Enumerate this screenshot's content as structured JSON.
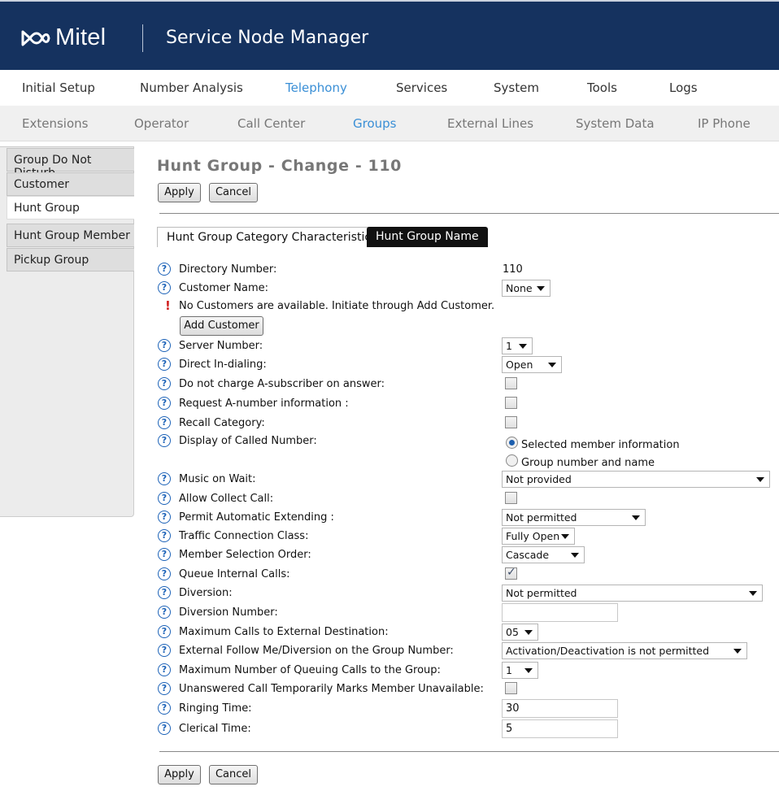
{
  "header": {
    "brand": "Mitel",
    "app_title": "Service Node Manager",
    "bg_color": "#15325f"
  },
  "topnav": [
    "Initial Setup",
    "Number Analysis",
    "Telephony",
    "Services",
    "System",
    "Tools",
    "Logs"
  ],
  "topnav_active": "Telephony",
  "subnav": [
    "Extensions",
    "Operator",
    "Call Center",
    "Groups",
    "External Lines",
    "System Data",
    "IP Phone"
  ],
  "subnav_active": "Groups",
  "sidebar": [
    "Group Do Not Disturb",
    "Customer",
    "Hunt Group",
    "Hunt Group Member",
    "Pickup Group"
  ],
  "sidebar_active": "Hunt Group",
  "page": {
    "title": "Hunt Group - Change - 110",
    "apply": "Apply",
    "cancel": "Cancel",
    "tabs": [
      "Hunt Group Category Characteristics",
      "Hunt Group Name"
    ]
  },
  "form": {
    "directory_number": {
      "label": "Directory Number:",
      "value": "110"
    },
    "customer_name": {
      "label": "Customer Name:",
      "value": "None"
    },
    "no_customers_msg": "No Customers are available. Initiate through Add Customer.",
    "add_customer": "Add Customer",
    "server_number": {
      "label": "Server Number:",
      "value": "1"
    },
    "direct_in_dialing": {
      "label": "Direct In-dialing:",
      "value": "Open"
    },
    "no_charge_a_sub": {
      "label": "Do not charge A-subscriber on answer:",
      "checked": false
    },
    "request_a_number": {
      "label": "Request A-number information :",
      "checked": false
    },
    "recall_category": {
      "label": "Recall Category:",
      "checked": false
    },
    "display_called_number": {
      "label": "Display of Called Number:",
      "options": [
        "Selected member information",
        "Group number and name"
      ],
      "selected": "Selected member information"
    },
    "music_on_wait": {
      "label": "Music on Wait:",
      "value": "Not provided"
    },
    "allow_collect_call": {
      "label": "Allow Collect Call:",
      "checked": false
    },
    "permit_auto_extending": {
      "label": "Permit Automatic Extending :",
      "value": "Not permitted"
    },
    "traffic_connection_class": {
      "label": "Traffic Connection Class:",
      "value": "Fully Open"
    },
    "member_selection_order": {
      "label": "Member Selection Order:",
      "value": "Cascade"
    },
    "queue_internal_calls": {
      "label": "Queue Internal Calls:",
      "checked": true
    },
    "diversion": {
      "label": "Diversion:",
      "value": "Not permitted"
    },
    "diversion_number": {
      "label": "Diversion Number:",
      "value": ""
    },
    "max_calls_external": {
      "label": "Maximum Calls to External Destination:",
      "value": "05"
    },
    "ext_follow_me": {
      "label": "External Follow Me/Diversion on the Group Number:",
      "value": "Activation/Deactivation is not permitted"
    },
    "max_queuing_calls": {
      "label": "Maximum Number of Queuing Calls to the Group:",
      "value": "1"
    },
    "unanswered_marks_unavailable": {
      "label": "Unanswered Call Temporarily Marks Member Unavailable:",
      "checked": false
    },
    "ringing_time": {
      "label": "Ringing Time:",
      "value": "30"
    },
    "clerical_time": {
      "label": "Clerical Time:",
      "value": "5"
    }
  }
}
